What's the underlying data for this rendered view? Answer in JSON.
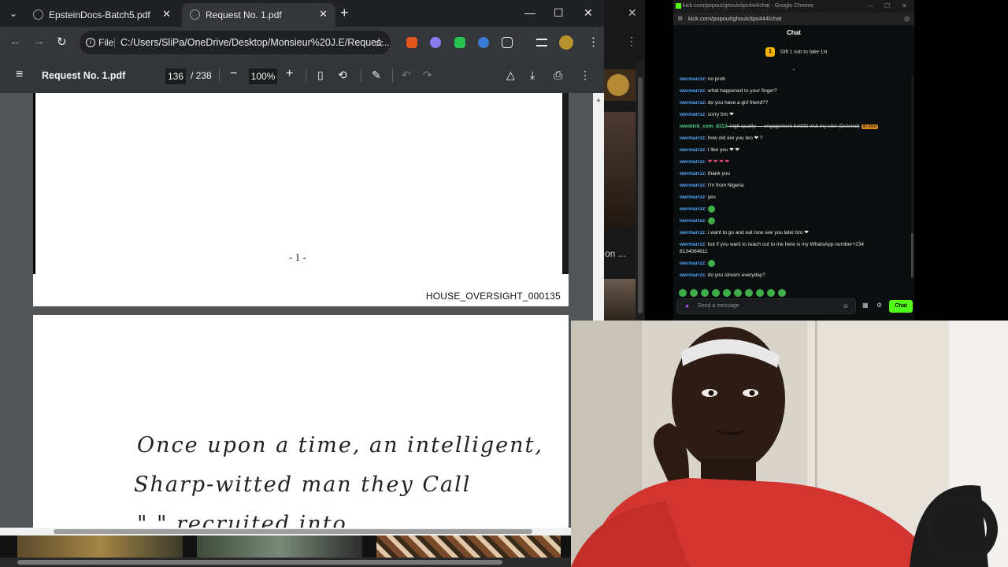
{
  "chrome": {
    "tabs": [
      {
        "title": "EpsteinDocs-Batch5.pdf"
      },
      {
        "title": "Request No. 1.pdf"
      }
    ],
    "omnibox": {
      "scheme_label": "File",
      "url": "C:/Users/SliPa/OneDrive/Desktop/Monsieur%20J.E/Reques..."
    },
    "icons": {
      "back": "←",
      "forward": "→",
      "reload": "↻",
      "new_tab": "+",
      "close": "✕",
      "minimize": "—",
      "maximize": "☐",
      "star": "☆"
    }
  },
  "pdf": {
    "title": "Request No. 1.pdf",
    "current_page": "136",
    "page_separator": "/",
    "total_pages": "238",
    "zoom": "100%",
    "page_number_text": "- 1 -",
    "bates_footer": "HOUSE_OVERSIGHT_000135",
    "handwriting": [
      "Once upon a time, an intelligent,",
      "Sharp-witted man they Call",
      "\"              \" recruited into"
    ]
  },
  "background_window": {
    "snippet": "on ..."
  },
  "kick_chat": {
    "window_title": "kick.com/popout/ghoulclips444/chat - Google Chrome",
    "url": "kick.com/popout/ghoulclips444/chat",
    "header": "Chat",
    "gift_badge": "1",
    "gift_text": "Gift 1 sub to take 1st",
    "messages": [
      {
        "user": "wermarrzz",
        "text": ": no prob"
      },
      {
        "user": "wermarrzz",
        "text": ": what happened to your finger?"
      },
      {
        "user": "wermarrzz",
        "text": ": do you have a girl friend??"
      },
      {
        "user": "wermarrzz",
        "text": ": sorry bro ❤"
      },
      {
        "user": "ownkick_com_8113",
        "text": ": high quality → engagement botttttt visit my site! (Deleted)",
        "tag": "AI Mod",
        "deleted": true
      },
      {
        "user": "wermarrzz",
        "text": ": how old are you bro ❤ ?"
      },
      {
        "user": "wermarrzz",
        "text": ": I like you ❤ ❤"
      },
      {
        "user": "wermarrzz",
        "text": ": ❤ ❤ ❤ ❤"
      },
      {
        "user": "wermarrzz",
        "text": ": thank you"
      },
      {
        "user": "wermarrzz",
        "text": ": I'm from Nigeria"
      },
      {
        "user": "wermarrzz",
        "text": ": yes"
      },
      {
        "user": "wermarrzz",
        "text": ":"
      },
      {
        "user": "wermarrzz",
        "text": ":"
      },
      {
        "user": "wermarrzz",
        "text": ": i want to go and eat now see you later bro ❤"
      },
      {
        "user": "wermarrzz",
        "text": ": but if you want to reach out to me here is my WhatsApp number+234"
      },
      {
        "user": "",
        "text": "8134084611"
      },
      {
        "user": "wermarrzz",
        "text": ":"
      },
      {
        "user": "wermarrzz",
        "text": ": do you stream everyday?"
      }
    ],
    "input_placeholder": "Send a message",
    "send_label": "Chat"
  },
  "colors": {
    "chrome_dark": "#202124",
    "kick_green": "#53fc18",
    "username_blue": "#4ea6ff",
    "sweater_red": "#d2352f"
  }
}
